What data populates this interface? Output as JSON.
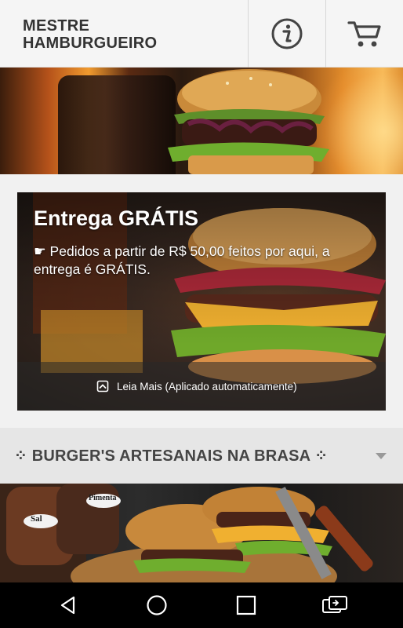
{
  "header": {
    "brand_line1": "MESTRE",
    "brand_line2": "HAMBURGUEIRO",
    "info_icon": "info-icon",
    "cart_icon": "cart-icon"
  },
  "promo": {
    "title": "Entrega GRÁTIS",
    "text": "☛ Pedidos a partir de R$ 50,00 feitos por aqui, a entrega é GRÁTIS.",
    "read_more": "Leia Mais (Aplicado automaticamente)"
  },
  "section": {
    "title": "⁘ BURGER'S ARTESANAIS NA BRASA ⁘"
  },
  "food_labels": {
    "salt": "Sal",
    "pepper": "Pimenta"
  },
  "navbar": {
    "back_icon": "back-icon",
    "home_icon": "home-icon",
    "recents_icon": "recents-icon",
    "rotate_icon": "screen-rotate-icon"
  },
  "colors": {
    "header_bg": "#f5f5f5",
    "section_bg": "#e6e6e6",
    "text_dark": "#333333"
  }
}
